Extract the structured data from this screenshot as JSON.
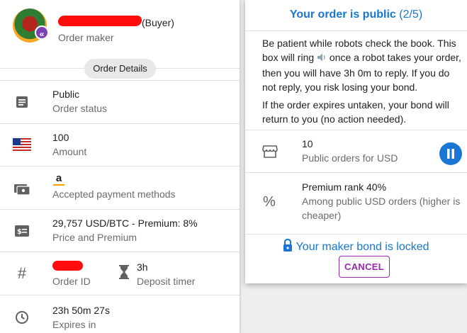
{
  "maker": {
    "buyer_tag": "(Buyer)",
    "role": "Order maker",
    "badge_icon": "chevron-double-left-icon"
  },
  "details_chip": "Order Details",
  "rows": {
    "status": {
      "primary": "Public",
      "secondary": "Order status",
      "icon": "article-icon"
    },
    "amount": {
      "primary": "100",
      "secondary": "Amount",
      "icon": "us-flag-icon"
    },
    "payment": {
      "secondary": "Accepted payment methods",
      "icon": "payments-icon",
      "method_icon": "amazon-icon",
      "method_glyph": "a"
    },
    "price": {
      "primary": "29,757 USD/BTC - Premium: 8%",
      "secondary": "Price and Premium",
      "icon": "price-change-icon"
    },
    "order_id": {
      "secondary": "Order ID",
      "icon": "hash-icon"
    },
    "deposit": {
      "primary": "3h",
      "secondary": "Deposit timer",
      "icon": "hourglass-icon"
    },
    "expires": {
      "primary": "23h 50m 27s",
      "secondary": "Expires in",
      "icon": "clock-icon"
    }
  },
  "panel": {
    "title": "Your order is public",
    "step": "(2/5)",
    "para1_a": "Be patient while robots check the book. This box will ring ",
    "para1_b": " once a robot takes your order, then you will have 3h 0m to reply. If you do not reply, you risk losing your bond.",
    "para2": "If the order expires untaken, your bond will return to you (no action needed).",
    "public_orders": {
      "primary": "10",
      "secondary": "Public orders for USD",
      "icon": "storefront-icon"
    },
    "premium_rank": {
      "primary": "Premium rank 40%",
      "secondary": "Among public USD orders (higher is cheaper)",
      "icon": "percent-icon"
    },
    "bond_locked": "Your maker bond is locked",
    "cancel_label": "CANCEL"
  },
  "colors": {
    "accent": "#1976d2",
    "cancel": "#9c27b0",
    "redaction": "#ff0c0c"
  }
}
